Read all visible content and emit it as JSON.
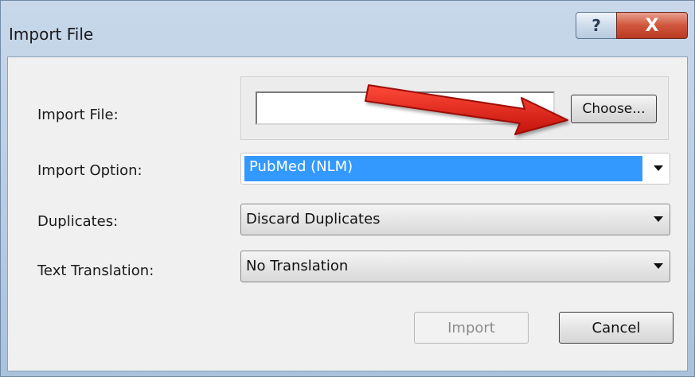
{
  "window": {
    "title": "Import File",
    "help_label": "?",
    "close_label": "X"
  },
  "form": {
    "import_file_label": "Import File:",
    "import_file_value": "",
    "choose_label": "Choose...",
    "import_option_label": "Import Option:",
    "import_option_value": "PubMed (NLM)",
    "duplicates_label": "Duplicates:",
    "duplicates_value": "Discard Duplicates",
    "text_translation_label": "Text Translation:",
    "text_translation_value": "No Translation"
  },
  "buttons": {
    "import_label": "Import",
    "import_enabled": false,
    "cancel_label": "Cancel"
  },
  "colors": {
    "selection": "#3399ff",
    "annotation_arrow": "#e01b12",
    "close_button": "#d0563c"
  },
  "icons": {
    "dropdown": "chevron-down-icon",
    "annotation": "red-arrow-icon"
  }
}
